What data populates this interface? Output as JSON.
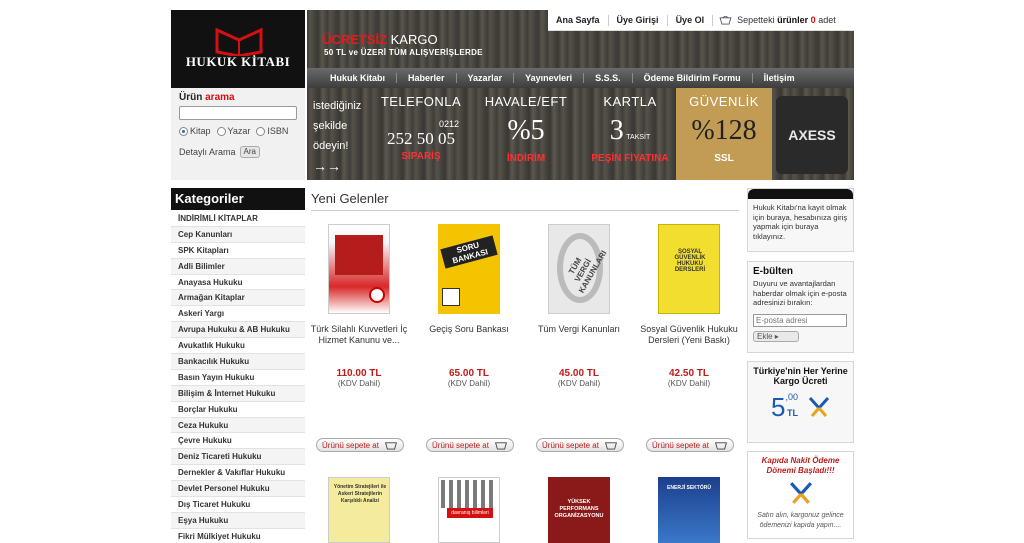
{
  "brand": {
    "name": "HUKUK KİTABI"
  },
  "top_links": {
    "home": "Ana Sayfa",
    "login": "Üye Girişi",
    "register": "Üye Ol",
    "cart_prefix": "Sepetteki",
    "cart_bold": "ürünler",
    "cart_count": "0",
    "cart_suffix": "adet"
  },
  "banner": {
    "free": "ÜCRETSİZ",
    "kargo": "KARGO",
    "subtitle": "50 TL ve ÜZERİ TÜM ALIŞVERİŞLERDE"
  },
  "nav": [
    "Hukuk Kitabı",
    "Haberler",
    "Yazarlar",
    "Yayınevleri",
    "S.S.S.",
    "Ödeme Bildirim Formu",
    "İletişim"
  ],
  "promo": {
    "lead_1": "istediğiniz",
    "lead_2": "şekilde",
    "lead_3": "ödeyin!",
    "phone": {
      "head": "TELEFONLA",
      "number_top": "0212",
      "number": "252 50 05",
      "foot": "SİPARİŞ"
    },
    "havale": {
      "head": "HAVALE/EFT",
      "big": "%5",
      "foot": "İNDİRİM"
    },
    "kart": {
      "head": "KARTLA",
      "big": "3",
      "small": "TAKSİT",
      "foot": "PEŞİN FİYATINA"
    },
    "guvenlik": {
      "head": "GÜVENLİK",
      "big": "%128",
      "foot": "SSL"
    },
    "axess": "AXESS"
  },
  "search": {
    "label_1": "Ürün",
    "label_2": "arama",
    "placeholder": "",
    "options": [
      "Kitap",
      "Yazar",
      "ISBN"
    ],
    "selected": "Kitap",
    "advanced": "Detaylı Arama",
    "button": "Ara"
  },
  "categories": {
    "title": "Kategoriler",
    "items": [
      "İNDİRİMLİ KİTAPLAR",
      "Cep Kanunları",
      "SPK Kitapları",
      "Adli Bilimler",
      "Anayasa Hukuku",
      "Armağan Kitaplar",
      "Askeri Yargı",
      "Avrupa Hukuku & AB Hukuku",
      "Avukatlık Hukuku",
      "Bankacılık Hukuku",
      "Basın Yayın Hukuku",
      "Bilişim & İnternet Hukuku",
      "Borçlar Hukuku",
      "Ceza Hukuku",
      "Çevre Hukuku",
      "Deniz Ticareti Hukuku",
      "Dernekler & Vakıflar Hukuku",
      "Devlet Personel Hukuku",
      "Dış Ticaret Hukuku",
      "Eşya Hukuku",
      "Fikri Mülkiyet Hukuku"
    ]
  },
  "main": {
    "title": "Yeni Gelenler",
    "add_label": "Ürünü sepete at",
    "kdv": "(KDV Dahil)",
    "products": [
      {
        "name": "Türk Silahlı Kuvvetleri İç Hizmet Kanunu ve...",
        "price": "110.00 TL"
      },
      {
        "name": "Geçiş Soru Bankası",
        "price": "65.00 TL",
        "cover_title": "SORU BANKASI"
      },
      {
        "name": "Tüm Vergi Kanunları",
        "price": "45.00 TL",
        "cover_title": "TÜM VERGİ KANUNLARI"
      },
      {
        "name": "Sosyal Güvenlik Hukuku Dersleri (Yeni Baskı)",
        "price": "42.50 TL",
        "cover_title": "SOSYAL GÜVENLİK HUKUKU DERSLERİ"
      }
    ],
    "row2_covers": [
      "Yönetim Stratejileri ile Askeri Stratejilerin Karşılıklı Analizi",
      "davranış bilimleri",
      "YÜKSEK PERFORMANS ORGANİZASYONU",
      "ENERJİ SEKTÖRÜ"
    ]
  },
  "right": {
    "login_text": "Hukuk Kitabı'na kayıt olmak için buraya, hesabınıza giriş yapmak için buraya tıklayınız.",
    "ebulten_title": "E-bülten",
    "ebulten_text": "Duyuru ve avantajlardan haberdar olmak için e-posta adresinizi bırakın:",
    "ebulten_placeholder": "E-posta adresi",
    "ebulten_button": "Ekle",
    "kargo_title": "Türkiye'nin Her Yerine Kargo Ücreti",
    "kargo_price": "5",
    "kargo_cents": ",00",
    "kargo_unit": "TL",
    "kapida_title": "Kapıda Nakit Ödeme Dönemi Başladı!!!",
    "kapida_text": "Satın alın, kargonuz gelince ödemenizi kapıda yapın...."
  },
  "colors": {
    "accent": "#d41010",
    "dark": "#111111",
    "price": "#c01a1a"
  }
}
